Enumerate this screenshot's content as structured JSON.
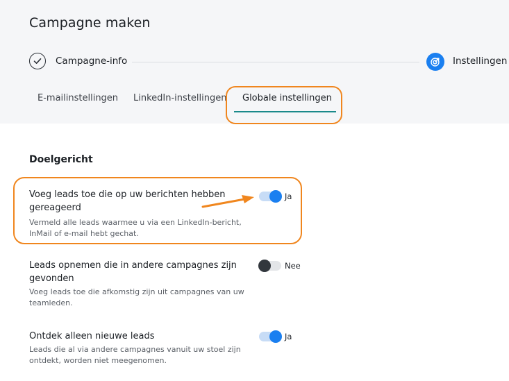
{
  "page": {
    "title": "Campagne maken"
  },
  "stepper": {
    "steps": [
      {
        "label": "Campagne-info",
        "state": "completed",
        "icon": "check-icon"
      },
      {
        "label": "Instellingen",
        "state": "active",
        "icon": "target-icon"
      }
    ]
  },
  "tabs": [
    {
      "label": "E-mailinstellingen",
      "active": false
    },
    {
      "label": "LinkedIn-instellingen",
      "active": false
    },
    {
      "label": "Globale instellingen",
      "active": true
    }
  ],
  "section": {
    "title": "Doelgericht",
    "settings": [
      {
        "title": "Voeg leads toe die op uw berichten hebben gereageerd",
        "description": "Vermeld alle leads waarmee u via een LinkedIn-bericht, InMail of e-mail hebt gechat.",
        "enabled": true,
        "state_label": "Ja"
      },
      {
        "title": "Leads opnemen die in andere campagnes zijn gevonden",
        "description": "Voeg leads toe die afkomstig zijn uit campagnes van uw teamleden.",
        "enabled": false,
        "state_label": "Nee"
      },
      {
        "title": "Ontdek alleen nieuwe leads",
        "description": "Leads die al via andere campagnes vanuit uw stoel zijn ontdekt, worden niet meegenomen.",
        "enabled": true,
        "state_label": "Ja"
      }
    ]
  },
  "colors": {
    "accent": "#1a7ff0",
    "highlight": "#f0861e",
    "tab_underline": "#1a8a8a",
    "header_background": "#f5f6f8"
  }
}
